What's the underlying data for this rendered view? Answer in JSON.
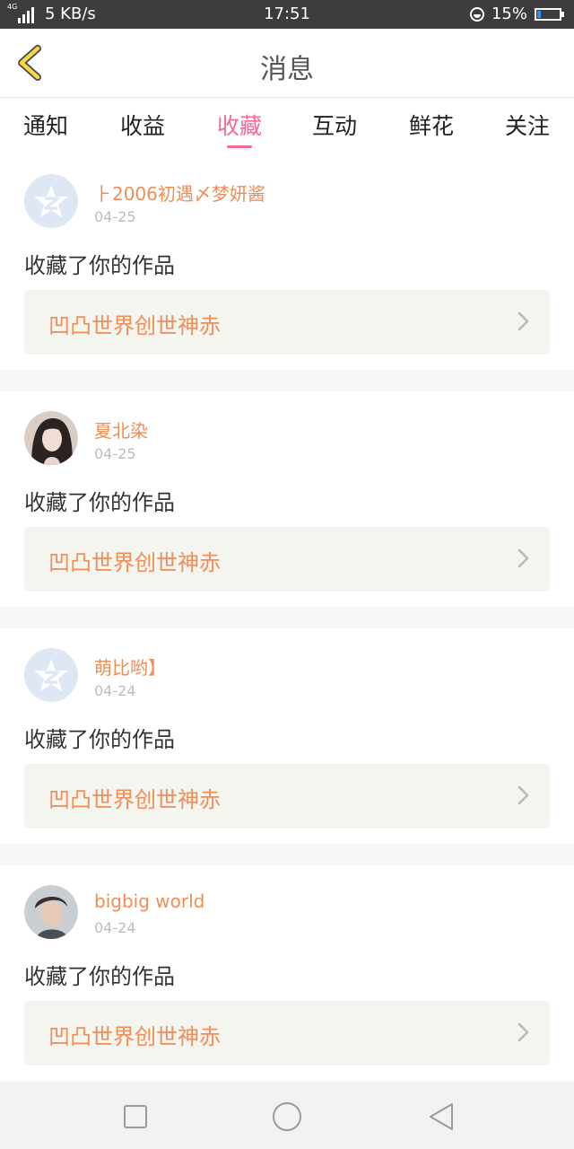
{
  "status_bar": {
    "network_tag": "4G",
    "speed": "5 KB/s",
    "time": "17:51",
    "battery": "15%",
    "battery_level": 0.15,
    "icons": [
      "signal-icon",
      "sync-icon",
      "battery-icon"
    ]
  },
  "header": {
    "title": "消息",
    "back_icon": "chevron-left-icon"
  },
  "tabs": [
    {
      "label": "通知",
      "active": false
    },
    {
      "label": "收益",
      "active": false
    },
    {
      "label": "收藏",
      "active": true
    },
    {
      "label": "互动",
      "active": false
    },
    {
      "label": "鲜花",
      "active": false
    },
    {
      "label": "关注",
      "active": false
    }
  ],
  "items": [
    {
      "user": "⺊2006初遇〆梦妍酱",
      "date": "04-25",
      "action": "收藏了你的作品",
      "work": "凹凸世界创世神赤",
      "avatar": "default-avatar"
    },
    {
      "user": "夏北染",
      "date": "04-25",
      "action": "收藏了你的作品",
      "work": "凹凸世界创世神赤",
      "avatar": "photo-avatar"
    },
    {
      "user": "萌比哟】",
      "date": "04-24",
      "action": "收藏了你的作品",
      "work": "凹凸世界创世神赤",
      "avatar": "default-avatar"
    },
    {
      "user": "bigbig world",
      "date": "04-24",
      "action": "收藏了你的作品",
      "work": "凹凸世界创世神赤",
      "avatar": "photo-avatar"
    }
  ],
  "colors": {
    "accent_pink": "#ee6b9b",
    "accent_orange": "#ef8d57"
  },
  "bottom_nav": {
    "icons": [
      "square-icon",
      "circle-icon",
      "back-triangle-icon"
    ]
  }
}
